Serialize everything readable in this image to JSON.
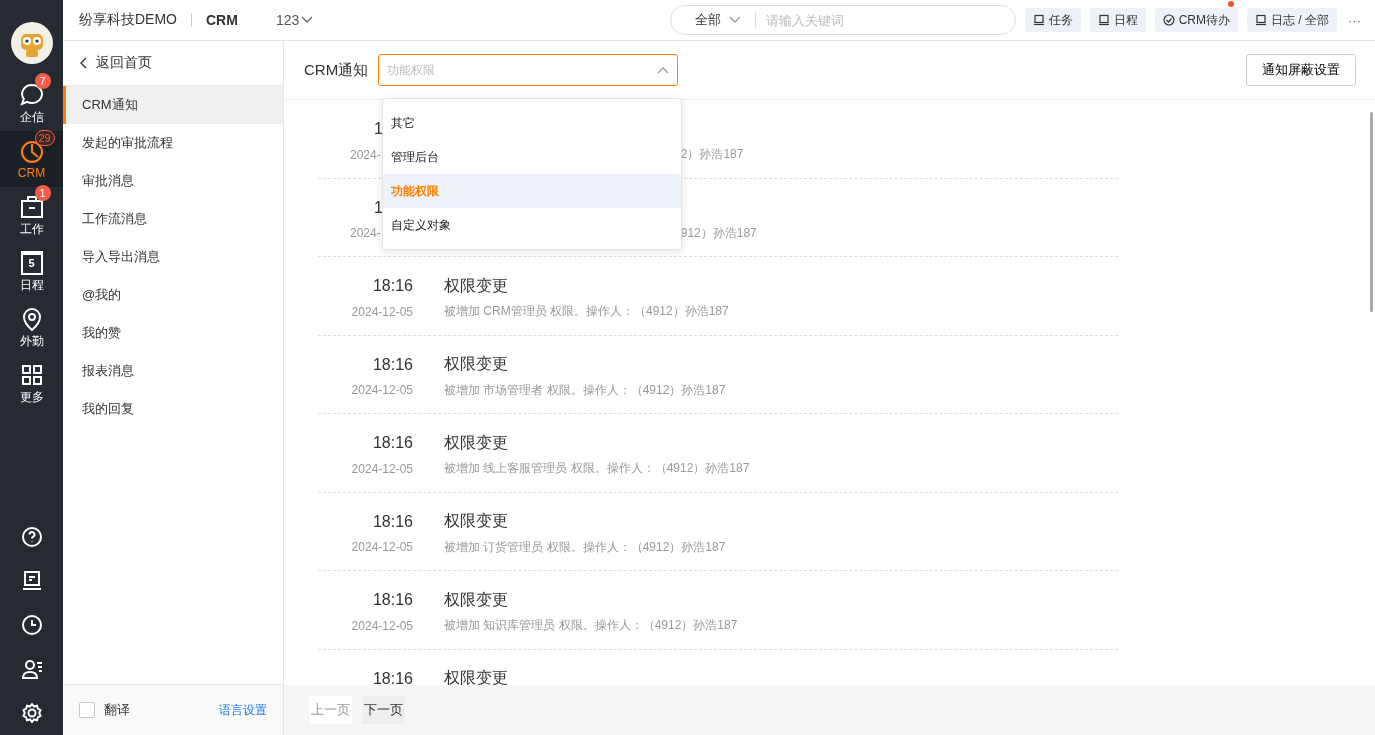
{
  "rail": {
    "items": [
      {
        "label": "企信",
        "badge": "7",
        "selected": false
      },
      {
        "label": "CRM",
        "badge": "29",
        "selected": true
      },
      {
        "label": "工作",
        "badge": "1",
        "selected": false
      },
      {
        "label": "日程",
        "day": "5",
        "selected": false
      },
      {
        "label": "外勤",
        "selected": false
      },
      {
        "label": "更多",
        "selected": false
      }
    ]
  },
  "top_bar": {
    "company": "纷享科技DEMO",
    "app": "CRM",
    "account": "123",
    "search": {
      "scope": "全部",
      "placeholder": "请输入关键词"
    },
    "shortcuts": [
      {
        "label": "任务"
      },
      {
        "label": "日程"
      },
      {
        "label": "CRM待办",
        "dot": true
      },
      {
        "label": "日志 / 全部"
      }
    ],
    "more": "···"
  },
  "sidebar": {
    "back": "返回首页",
    "items": [
      {
        "label": "CRM通知",
        "selected": true
      },
      {
        "label": "发起的审批流程",
        "selected": false
      },
      {
        "label": "审批消息",
        "selected": false
      },
      {
        "label": "工作流消息",
        "selected": false
      },
      {
        "label": "导入导出消息",
        "selected": false
      },
      {
        "label": "@我的",
        "selected": false
      },
      {
        "label": "我的赞",
        "selected": false
      },
      {
        "label": "报表消息",
        "selected": false
      },
      {
        "label": "我的回复",
        "selected": false
      }
    ],
    "translate": {
      "label": "翻译",
      "checked": false
    },
    "language_settings": "语言设置"
  },
  "main": {
    "title": "CRM通知",
    "filter": {
      "placeholder": "功能权限",
      "expanded": true,
      "options": [
        {
          "label": "其它",
          "selected": false
        },
        {
          "label": "管理后台",
          "selected": false
        },
        {
          "label": "功能权限",
          "selected": true
        },
        {
          "label": "自定义对象",
          "selected": false
        }
      ]
    },
    "mute_settings": "通知屏蔽设置",
    "notifications": [
      {
        "kind": "covered",
        "time": "1",
        "date": "2024-",
        "detail": "2）孙浩187"
      },
      {
        "kind": "covered",
        "time": "1",
        "date": "2024-",
        "detail": "912）孙浩187"
      },
      {
        "kind": "full",
        "time": "18:16",
        "title": "权限变更",
        "date": "2024-12-05",
        "detail": "被增加 CRM管理员 权限。操作人：（4912）孙浩187"
      },
      {
        "kind": "full",
        "time": "18:16",
        "title": "权限变更",
        "date": "2024-12-05",
        "detail": "被增加 市场管理者 权限。操作人：（4912）孙浩187"
      },
      {
        "kind": "full",
        "time": "18:16",
        "title": "权限变更",
        "date": "2024-12-05",
        "detail": "被增加 线上客服管理员 权限。操作人：（4912）孙浩187"
      },
      {
        "kind": "full",
        "time": "18:16",
        "title": "权限变更",
        "date": "2024-12-05",
        "detail": "被增加 订货管理员 权限。操作人：（4912）孙浩187"
      },
      {
        "kind": "full",
        "time": "18:16",
        "title": "权限变更",
        "date": "2024-12-05",
        "detail": "被增加 知识库管理员 权限。操作人：（4912）孙浩187"
      },
      {
        "kind": "cut",
        "time": "18:16",
        "title": "权限变更"
      }
    ],
    "pager": {
      "prev": {
        "label": "上一页",
        "disabled": true
      },
      "next": {
        "label": "下一页",
        "disabled": false
      }
    }
  }
}
